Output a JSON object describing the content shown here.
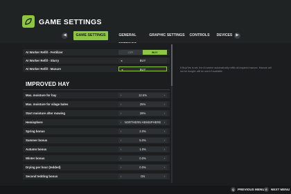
{
  "header": {
    "title": "GAME SETTINGS",
    "logo_icon": "farm-logo-icon",
    "accent": "#8dc63f"
  },
  "tabs": [
    {
      "label": "GAME SETTINGS",
      "active": true
    },
    {
      "label": "GENERAL SETTINGS",
      "active": false
    },
    {
      "label": "GRAPHIC SETTINGS",
      "active": false
    },
    {
      "label": "CONTROLS",
      "active": false
    },
    {
      "label": "DEVICES",
      "active": false
    }
  ],
  "nav": {
    "prev_icon": "chevron-left-icon",
    "next_icon": "chevron-right-icon"
  },
  "worker_rows": [
    {
      "label": "AI Worker Refill - Fertilizer",
      "off_label": "OFF",
      "on_label": "BUY"
    },
    {
      "label": "AI Worker Refill - Slurry",
      "value": "BUY"
    },
    {
      "label": "AI Worker Refill - Manure",
      "value": "BUY"
    }
  ],
  "section_title": "IMPROVED HAY",
  "hay_rows": [
    {
      "label": "Max. moisture for hay",
      "value": "12.5%"
    },
    {
      "label": "Max. moisture for silage bales",
      "value": "25%"
    },
    {
      "label": "Start moisture after mowing",
      "value": "28%"
    },
    {
      "label": "Hemisphere",
      "value": "NORTHERN HEMISPHERE"
    },
    {
      "label": "Spring bonus",
      "value": "2.0%"
    },
    {
      "label": "Summer bonus",
      "value": "5.0%"
    },
    {
      "label": "Autumn bonus",
      "value": "1.0%"
    },
    {
      "label": "Winter bonus",
      "value": "0.0%"
    },
    {
      "label": "Drying per hour (tedded)",
      "value": "0.0%"
    },
    {
      "label": "Second tedding bonus",
      "value": "ON"
    }
  ],
  "help_text": "If Buy/Yes is set, the AI worker automatically refills all required manure. Manure will not be bought; will be used if available.",
  "footer": {
    "prev_menu_key": "Q",
    "prev_menu": "PREVIOUS MENU",
    "next_menu_key": "E",
    "next_menu": "NEXT MENU"
  }
}
